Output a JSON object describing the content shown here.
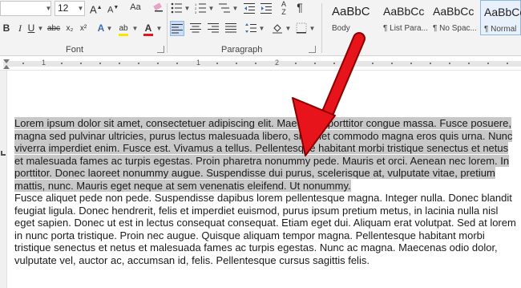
{
  "font": {
    "name": "",
    "size": "12"
  },
  "toolbar": {
    "grow_font": "A",
    "shrink_font": "A",
    "change_case": "Aa",
    "bold": "B",
    "italic": "I",
    "underline": "U",
    "strikethrough": "abc",
    "subscript": "x₂",
    "superscript": "x²",
    "font_color": "A",
    "highlight": "ab",
    "show_marks": "¶"
  },
  "groups": {
    "font": "Font",
    "paragraph": "Paragraph"
  },
  "styles": [
    {
      "sample": "AaBbC",
      "name": "Body"
    },
    {
      "sample": "AaBbCc",
      "name": "¶ List Para..."
    },
    {
      "sample": "AaBbCc",
      "name": "¶ No Spac..."
    },
    {
      "sample": "AaBbCc",
      "name": "¶ Normal"
    }
  ],
  "ruler": {
    "numbers": [
      "1",
      "1",
      "2"
    ]
  },
  "document": {
    "selected_paragraph": "Lorem ipsum dolor sit amet, consectetuer adipiscing elit. Maecenas porttitor congue massa. Fusce posuere, magna sed pulvinar ultricies, purus lectus malesuada libero, sit amet commodo magna eros quis urna. Nunc viverra imperdiet enim. Fusce est. Vivamus a tellus. Pellentesque habitant morbi tristique senectus et netus et malesuada fames ac turpis egestas. Proin pharetra nonummy pede. Mauris et orci. Aenean nec lorem. In porttitor. Donec laoreet nonummy augue. Suspendisse dui purus, scelerisque at, vulputate vitae, pretium mattis, nunc. Mauris eget neque at sem venenatis eleifend. Ut nonummy.",
    "second_paragraph": "Fusce aliquet pede non pede. Suspendisse dapibus lorem pellentesque magna. Integer nulla. Donec blandit feugiat ligula. Donec hendrerit, felis et imperdiet euismod, purus ipsum pretium metus, in lacinia nulla nisl eget sapien. Donec ut est in lectus consequat consequat. Etiam eget dui. Aliquam erat volutpat. Sed at lorem in nunc porta tristique. Proin nec augue. Quisque aliquam tempor magna. Pellentesque habitant morbi tristique senectus et netus et malesuada fames ac turpis egestas. Nunc ac magna. Maecenas odio dolor, vulputate vel, auctor ac, accumsan id, felis. Pellentesque cursus sagittis felis."
  },
  "colors": {
    "arrow": "#e8141b",
    "selection": "#c8c8c8",
    "font_color_bar": "#e8141b",
    "highlight_bar": "#f7e600"
  }
}
